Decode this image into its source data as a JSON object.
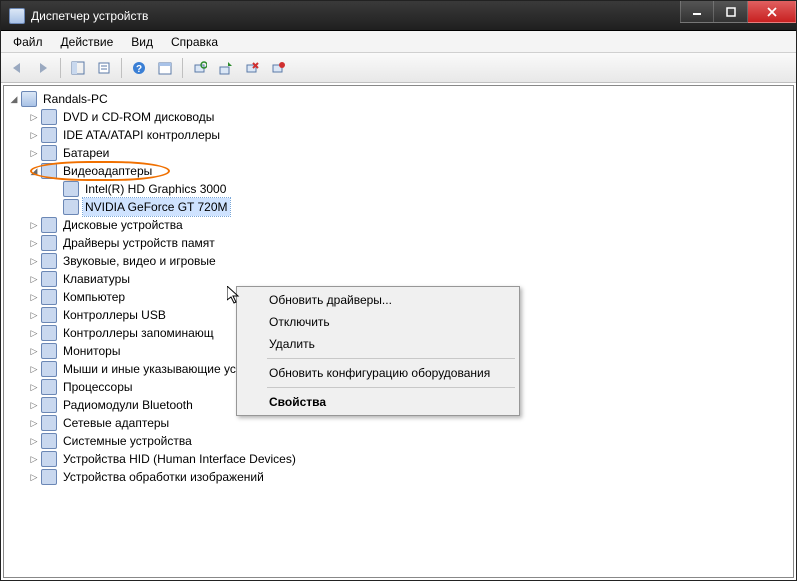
{
  "window": {
    "title": "Диспетчер устройств"
  },
  "menu": {
    "file": "Файл",
    "action": "Действие",
    "view": "Вид",
    "help": "Справка"
  },
  "tree": {
    "root": "Randals-PC",
    "items": [
      "DVD и CD-ROM дисководы",
      "IDE ATA/ATAPI контроллеры",
      "Батареи",
      "Видеоадаптеры",
      "Дисковые устройства",
      "Драйверы устройств памят",
      "Звуковые, видео и игровые",
      "Клавиатуры",
      "Компьютер",
      "Контроллеры USB",
      "Контроллеры запоминающ",
      "Мониторы",
      "Мыши и иные указывающие устройства",
      "Процессоры",
      "Радиомодули Bluetooth",
      "Сетевые адаптеры",
      "Системные устройства",
      "Устройства HID (Human Interface Devices)",
      "Устройства обработки изображений"
    ],
    "video": {
      "child0": "Intel(R) HD Graphics 3000",
      "child1": "NVIDIA GeForce GT 720M"
    }
  },
  "context": {
    "update": "Обновить драйверы...",
    "disable": "Отключить",
    "delete": "Удалить",
    "scan": "Обновить конфигурацию оборудования",
    "props": "Свойства"
  }
}
